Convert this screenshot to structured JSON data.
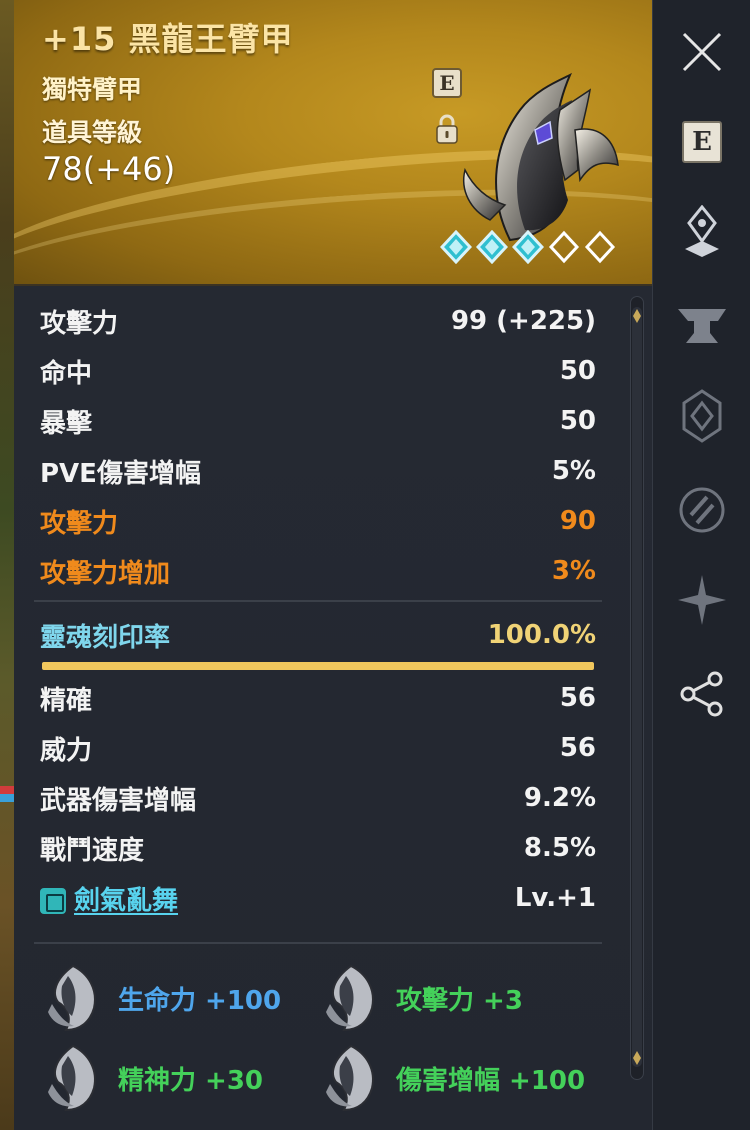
{
  "item": {
    "title": "+15 黑龍王臂甲",
    "type": "獨特臂甲",
    "level_label": "道具等級",
    "level_value": "78(+46)",
    "badge_e": "E",
    "stars_filled": 3,
    "stars_total": 5
  },
  "stats": [
    {
      "label": "攻擊力",
      "value": "99 (+225)",
      "color": "white"
    },
    {
      "label": "命中",
      "value": "50",
      "color": "white"
    },
    {
      "label": "暴擊",
      "value": "50",
      "color": "white"
    },
    {
      "label": "PVE傷害增幅",
      "value": "5%",
      "color": "white"
    },
    {
      "label": "攻擊力",
      "value": "90",
      "color": "orange"
    },
    {
      "label": "攻擊力增加",
      "value": "3%",
      "color": "orange"
    }
  ],
  "soul": {
    "label": "靈魂刻印率",
    "value": "100.0%"
  },
  "soul_stats": [
    {
      "label": "精確",
      "value": "56"
    },
    {
      "label": "威力",
      "value": "56"
    },
    {
      "label": "武器傷害增幅",
      "value": "9.2%"
    },
    {
      "label": "戰鬥速度",
      "value": "8.5%"
    }
  ],
  "skill": {
    "label": "劍氣亂舞",
    "value": "Lv.+1"
  },
  "bonuses": [
    {
      "text": "生命力 +100",
      "color": "blue"
    },
    {
      "text": "攻擊力 +3",
      "color": "green"
    },
    {
      "text": "精神力 +30",
      "color": "green"
    },
    {
      "text": "傷害增幅 +100",
      "color": "green"
    }
  ],
  "sidebar": {
    "e_label": "E"
  },
  "colors": {
    "orange": "#f08a1c",
    "cyan": "#7fd6ec",
    "gold": "#f0d376",
    "blue": "#4fa6ec",
    "green": "#44d15a"
  }
}
